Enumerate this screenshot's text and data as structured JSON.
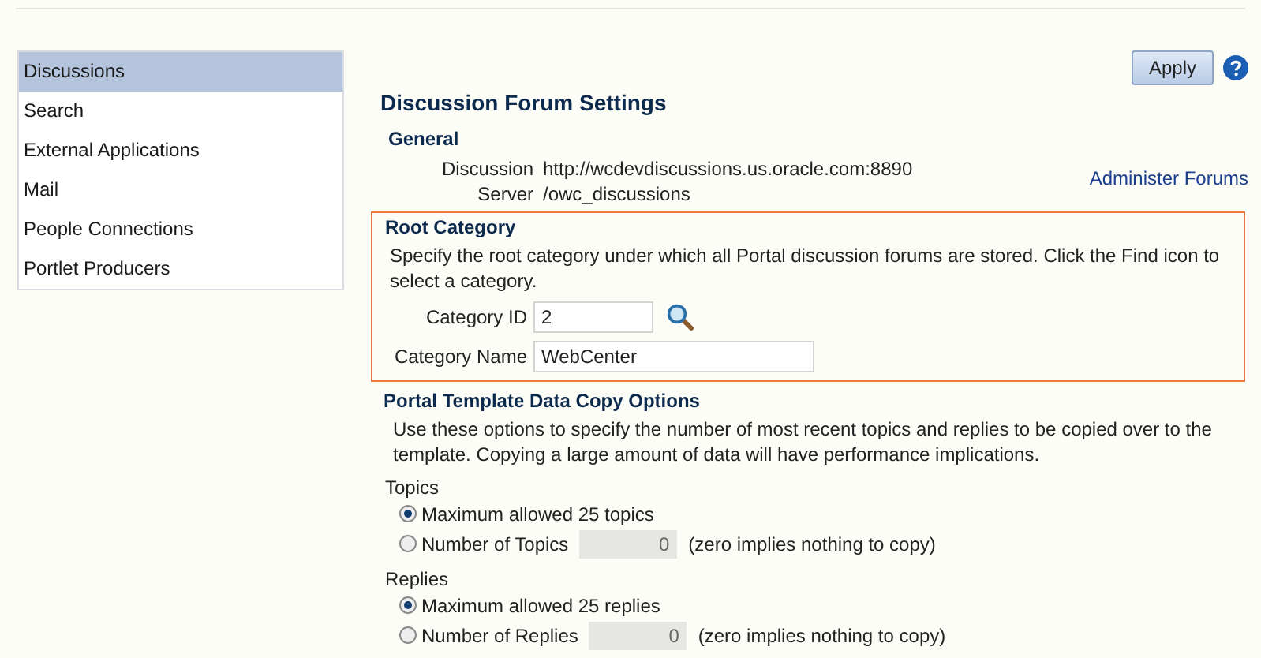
{
  "sidebar": {
    "items": [
      {
        "label": "Discussions",
        "selected": true
      },
      {
        "label": "Search",
        "selected": false
      },
      {
        "label": "External Applications",
        "selected": false
      },
      {
        "label": "Mail",
        "selected": false
      },
      {
        "label": "People Connections",
        "selected": false
      },
      {
        "label": "Portlet Producers",
        "selected": false
      }
    ]
  },
  "toolbar": {
    "apply": "Apply"
  },
  "title": "Discussion Forum Settings",
  "general": {
    "heading": "General",
    "label": "Discussion Server",
    "value": "http://wcdevdiscussions.us.oracle.com:8890 /owc_discussions",
    "link": "Administer Forums"
  },
  "root_category": {
    "heading": "Root Category",
    "description": "Specify the root category under which all Portal discussion forums are stored. Click the Find icon to select a category.",
    "fields": [
      {
        "kind": "search",
        "label": "Category ID",
        "value": "2"
      },
      {
        "kind": "plain",
        "label": "Category Name",
        "value": "WebCenter"
      }
    ]
  },
  "copy_options": {
    "heading": "Portal Template Data Copy Options",
    "description": "Use these options to specify the number of most recent topics and replies to be copied over to the template. Copying a large amount of data will have performance implications.",
    "groups": [
      {
        "label": "Topics",
        "options": [
          {
            "kind": "text",
            "label": "Maximum allowed 25 topics",
            "selected": true
          },
          {
            "kind": "count",
            "label": "Number of Topics",
            "value": "0",
            "note": "(zero implies nothing to copy)",
            "selected": false
          }
        ]
      },
      {
        "label": "Replies",
        "options": [
          {
            "kind": "text",
            "label": "Maximum allowed 25 replies",
            "selected": true
          },
          {
            "kind": "count",
            "label": "Number of Replies",
            "value": "0",
            "note": "(zero implies nothing to copy)",
            "selected": false
          }
        ]
      }
    ]
  }
}
